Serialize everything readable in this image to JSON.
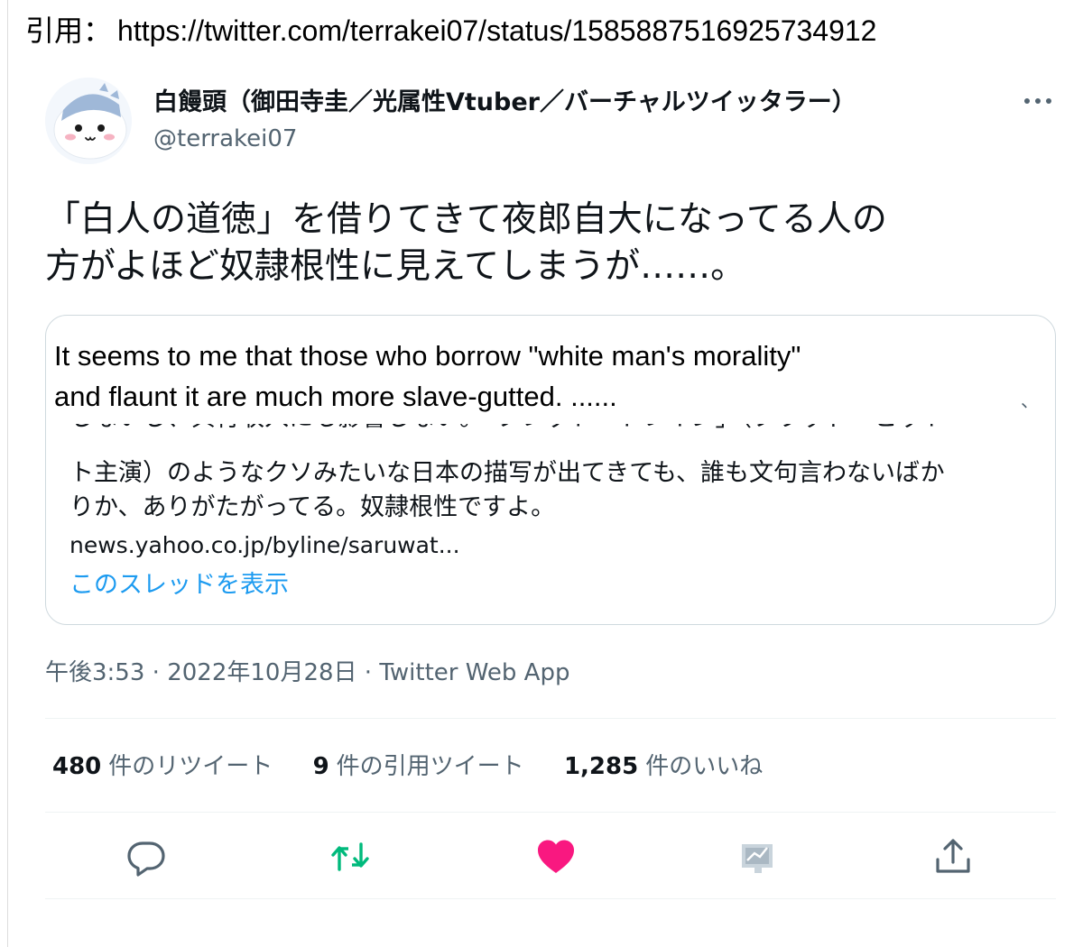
{
  "quote_header": {
    "label": "引用：",
    "url": "https://twitter.com/terrakei07/status/1585887516925734912"
  },
  "tweet": {
    "author": {
      "name": "白饅頭（御田寺圭／光属性Vtuber／バーチャルツイッタラー）",
      "handle": "@terrakei07"
    },
    "text_line1": "「白人の道徳」を借りてきて夜郎自大になってる人の",
    "text_line2": "方がよほど奴隷根性に見えてしまうが……。",
    "quoted": {
      "cut_line": "しないし、興行収入にも影響しない。「ブレット・トレイン」（ブラッド・ピット",
      "text_line1": "ト主演）のようなクソみたいな日本の描写が出てきても、誰も文句言わないばか",
      "text_line2": "りか、ありがたがってる。奴隷根性ですよ。",
      "link": "news.yahoo.co.jp/byline/saruwat...",
      "show_thread": "このスレッドを表示"
    },
    "translation_line1": "It seems to me that those who borrow \"white man's morality\"",
    "translation_line2": "and flaunt it are much more slave-gutted. ......",
    "translation_mark": "、",
    "meta": {
      "time": "午後3:53",
      "sep": " · ",
      "date": "2022年10月28日",
      "sep2": " · ",
      "app": "Twitter Web App"
    },
    "stats": {
      "retweets_count": "480",
      "retweets_label": "件のリツイート",
      "quotes_count": "9",
      "quotes_label": "件の引用ツイート",
      "likes_count": "1,285",
      "likes_label": "件のいいね"
    }
  },
  "icons": {
    "more": "more-horizontal-icon",
    "reply": "reply-icon",
    "retweet": "retweet-icon",
    "like": "heart-icon",
    "analytics": "analytics-icon",
    "share": "share-icon"
  },
  "colors": {
    "accent_blue": "#1d9bf0",
    "retweet_green": "#00ba7c",
    "like_pink": "#f91880",
    "secondary_text": "#536471",
    "border": "#cfd9de"
  }
}
